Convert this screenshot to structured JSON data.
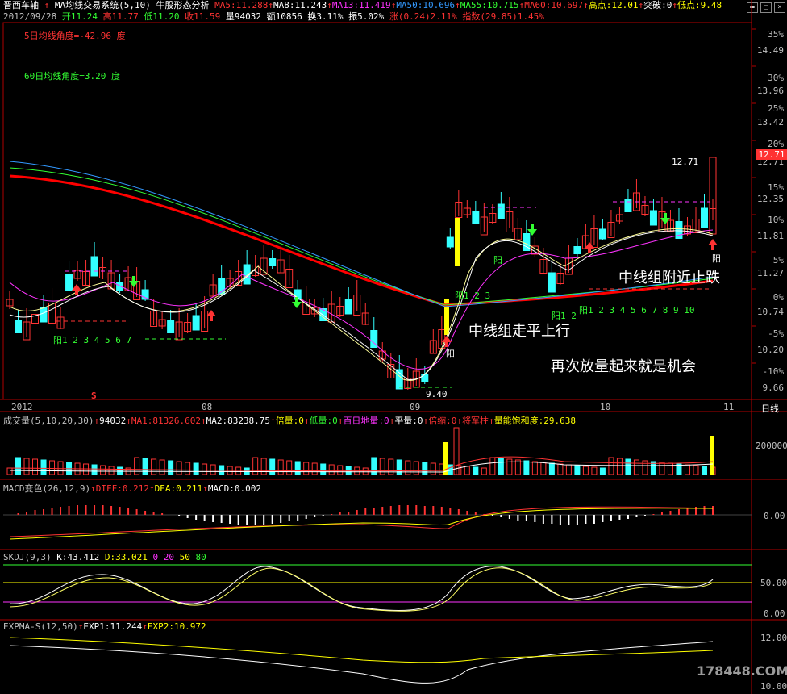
{
  "window": {
    "stock_name": "晋西车轴",
    "indicator": "MA均线交易系统(5,10)",
    "pattern": "牛股形态分析"
  },
  "ma_line": [
    {
      "label": "MA5:11.288",
      "color": "#ff3333"
    },
    {
      "label": "MA8:11.243",
      "color": "#ffffff"
    },
    {
      "label": "MA13:11.419",
      "color": "#ff33ff"
    },
    {
      "label": "MA50:10.696",
      "color": "#3399ff"
    },
    {
      "label": "MA55:10.715",
      "color": "#33ff33"
    },
    {
      "label": "MA60:10.697",
      "color": "#ff3333"
    },
    {
      "label": "高点:12.01",
      "color": "#ffff00"
    },
    {
      "label": "突破:0",
      "color": "#ffffff"
    },
    {
      "label": "低点:9.48",
      "color": "#ffff00"
    }
  ],
  "quote_line": [
    {
      "label": "2012/09/28",
      "color": "#c0c0c0"
    },
    {
      "label": "开11.24",
      "color": "#33ff33"
    },
    {
      "label": "高11.77",
      "color": "#ff3333"
    },
    {
      "label": "低11.20",
      "color": "#33ff33"
    },
    {
      "label": "收11.59",
      "color": "#ff3333"
    },
    {
      "label": "量94032",
      "color": "#ffffff"
    },
    {
      "label": "额10856",
      "color": "#ffffff"
    },
    {
      "label": "换3.11%",
      "color": "#ffffff"
    },
    {
      "label": "振5.02%",
      "color": "#ffffff"
    },
    {
      "label": "涨(0.24)2.11%",
      "color": "#ff3333"
    },
    {
      "label": "指数(29.85)1.45%",
      "color": "#ff3333"
    }
  ],
  "angle5": "5日均线角度=-42.96 度",
  "angle60": "60日均线角度=3.20 度",
  "price_axis": [
    {
      "pct": "35%",
      "price": "14.49"
    },
    {
      "pct": "30%",
      "price": "13.96"
    },
    {
      "pct": "25%",
      "price": "13.42"
    },
    {
      "pct": "20%",
      "price": "12.71"
    },
    {
      "pct": "15%",
      "price": "12.35"
    },
    {
      "pct": "10%",
      "price": "11.81"
    },
    {
      "pct": "5%",
      "price": "11.27"
    },
    {
      "pct": "0%",
      "price": "10.74"
    },
    {
      "pct": "-5%",
      "price": "10.20"
    },
    {
      "pct": "-10%",
      "price": "9.66"
    }
  ],
  "current_price": "12.71",
  "price_labels": {
    "high": "12.71",
    "low": "9.40"
  },
  "annotations": {
    "a1": "中线组附近止跌",
    "a2": "中线组走平上行",
    "a3": "再次放量起来就是机会"
  },
  "chart_marks": {
    "yang": "阳",
    "seq1": "阳1 2 3 4 5 6 7",
    "seq2": "阳1 2 3",
    "seq3": "阳1 2",
    "seq4": "阳1 2 3 4 5 6 7 8 9 10",
    "s_mark": "S"
  },
  "date_axis": {
    "y2012": "2012",
    "m08": "08",
    "m09": "09",
    "m10": "10",
    "m11": "11",
    "right": "日线"
  },
  "volume": {
    "header": [
      {
        "label": "成交量(5,10,20,30)",
        "color": "#c0c0c0"
      },
      {
        "label": "94032",
        "color": "#ffffff"
      },
      {
        "label": "MA1:81326.602",
        "color": "#ff3333"
      },
      {
        "label": "MA2:83238.75",
        "color": "#ffffff"
      },
      {
        "label": "倍量:0",
        "color": "#ffff00"
      },
      {
        "label": "低量:0",
        "color": "#33ff33"
      },
      {
        "label": "百日地量:0",
        "color": "#ff33ff"
      },
      {
        "label": "平量:0",
        "color": "#ffffff"
      },
      {
        "label": "倍缩:0",
        "color": "#ff3333"
      },
      {
        "label": "将军柱",
        "color": "#ff3333"
      },
      {
        "label": "量能饱和度:29.638",
        "color": "#ffff00"
      }
    ],
    "axis": [
      "200000"
    ]
  },
  "macd": {
    "header": [
      {
        "label": "MACD变色(26,12,9)",
        "color": "#c0c0c0"
      },
      {
        "label": "DIFF:0.212",
        "color": "#ff3333"
      },
      {
        "label": "DEA:0.211",
        "color": "#ffff00"
      },
      {
        "label": "MACD:0.002",
        "color": "#ffffff"
      }
    ],
    "axis": [
      "0.00"
    ]
  },
  "skdj": {
    "header": [
      {
        "label": "SKDJ(9,3)",
        "color": "#c0c0c0"
      },
      {
        "label": "K:43.412",
        "color": "#ffffff"
      },
      {
        "label": "D:33.021",
        "color": "#ffff00"
      },
      {
        "label": "0",
        "color": "#ff33ff"
      },
      {
        "label": "20",
        "color": "#ff33ff"
      },
      {
        "label": "50",
        "color": "#ffff00"
      },
      {
        "label": "80",
        "color": "#33ff33"
      }
    ],
    "axis": [
      "50.00",
      "0.00"
    ]
  },
  "expma": {
    "header": [
      {
        "label": "EXPMA-S(12,50)",
        "color": "#c0c0c0"
      },
      {
        "label": "EXP1:11.244",
        "color": "#ffffff"
      },
      {
        "label": "EXP2:10.972",
        "color": "#ffff00"
      }
    ],
    "axis": [
      "12.00",
      "10.00"
    ]
  },
  "watermark": "178448.COM"
}
